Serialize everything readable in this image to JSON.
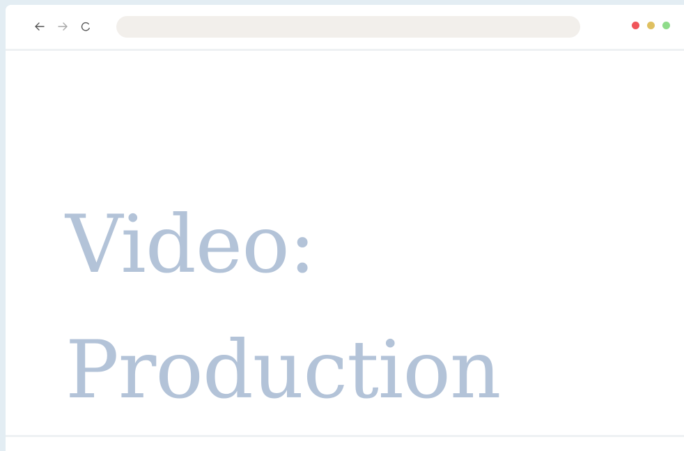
{
  "browser": {
    "address": {
      "value": "",
      "placeholder": ""
    },
    "nav": {
      "back_icon": "arrow-left-icon",
      "forward_icon": "arrow-right-icon",
      "reload_icon": "reload-icon"
    },
    "window_controls": [
      {
        "name": "close",
        "color": "#f0555a"
      },
      {
        "name": "minimize",
        "color": "#dfc060"
      },
      {
        "name": "maximize",
        "color": "#8fdc8a"
      }
    ]
  },
  "page": {
    "title_line_1": "Video:",
    "title_line_2": "Production",
    "title_color": "#b3c3d8"
  }
}
